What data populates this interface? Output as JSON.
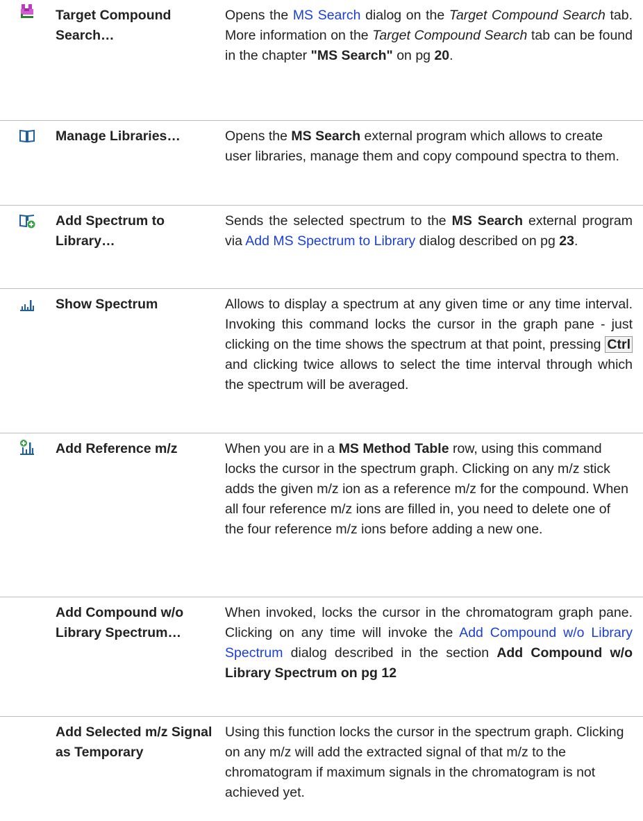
{
  "rows": [
    {
      "icon": "binoculars-icon",
      "command": "Target Compound Search…",
      "desc": {
        "t1": "Opens the ",
        "link": "MS Search",
        "t2": " dialog on the ",
        "i1": "Target Compound Search",
        "t3": " tab. More information on the ",
        "i2": "Target Compound Search",
        "t4": " tab can be found in the chapter ",
        "b1": "\"MS Search\"",
        "t5": " on pg ",
        "b2": "20",
        "t6": "."
      }
    },
    {
      "icon": "book-icon",
      "command": "Manage Libraries…",
      "desc": {
        "t1": "Opens the ",
        "b1": "MS Search",
        "t2": " external program which allows to create user libraries, manage them and copy compound spectra to them."
      }
    },
    {
      "icon": "book-add-icon",
      "command": "Add Spectrum to Library…",
      "desc": {
        "t1": "Sends the selected spectrum to the ",
        "b1": "MS Search",
        "t2": " external program via ",
        "link": "Add MS Spectrum to Library",
        "t3": " dialog described on pg ",
        "b2": "23",
        "t4": "."
      }
    },
    {
      "icon": "spectrum-icon",
      "command": "Show Spectrum",
      "desc": {
        "t1": "Allows to display a spectrum at any given time or any time interval. Invoking this command locks the cursor in the graph pane - just clicking on the time shows the spectrum at that point, pressing ",
        "key": "Ctrl",
        "t2": " and clicking twice allows to select the time interval through which the spectrum will be averaged."
      }
    },
    {
      "icon": "reference-mz-icon",
      "command": "Add Reference m/z",
      "desc": {
        "t1": "When you are in a ",
        "b1": "MS Method Table",
        "t2": " row, using this command locks the cursor in the spectrum graph. Clicking on any m/z stick adds the given m/z ion as a reference m/z for the compound. When all four reference m/z ions are filled in, you need to delete one of the four reference m/z ions before adding a new one."
      }
    },
    {
      "icon": "",
      "command": "Add Compound w/o Library Spectrum…",
      "desc": {
        "t1": "When invoked, locks the cursor in the chromatogram graph pane. Clicking on any time will invoke the ",
        "link": "Add Compound w/o Library Spectrum",
        "t2": " dialog described in the section ",
        "b1": "Add Compound w/o Library Spectrum on pg 12"
      }
    },
    {
      "icon": "",
      "command": "Add Selected m/z Signal as Temporary",
      "desc": {
        "t1": "Using this function locks the cursor in the spectrum graph. Clicking on any m/z will add the extracted signal of that m/z to the chromatogram if maximum signals in the chromatogram is not achieved yet."
      }
    }
  ],
  "colors": {
    "link": "#1a3fd6",
    "icon_magenta": "#c03ac0",
    "icon_green": "#3aa64a",
    "icon_blue": "#1f5f9e",
    "divider": "#bdbdbd"
  }
}
